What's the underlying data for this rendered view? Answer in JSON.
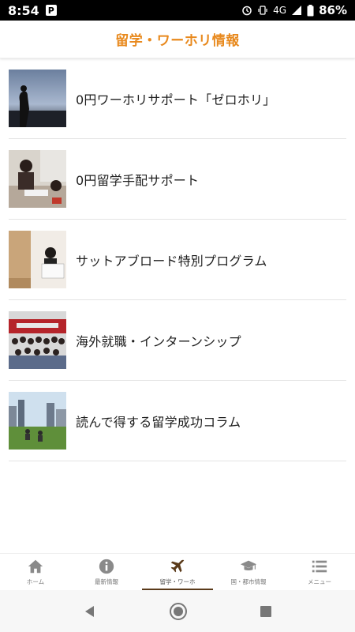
{
  "status_bar": {
    "time": "8:54",
    "app_icon": "P",
    "network": "4G",
    "battery_percent": "86%"
  },
  "header": {
    "title": "留学・ワーホリ情報",
    "accent_color": "#e8891d"
  },
  "items": [
    {
      "label": "0円ワーホリサポート「ゼロホリ」",
      "thumb_icon": "photo-silhouette-city"
    },
    {
      "label": "0円留学手配サポート",
      "thumb_icon": "photo-people-meeting"
    },
    {
      "label": "サットアブロード特別プログラム",
      "thumb_icon": "photo-student-certificate"
    },
    {
      "label": "海外就職・インターンシップ",
      "thumb_icon": "photo-group-office"
    },
    {
      "label": "読んで得する留学成功コラム",
      "thumb_icon": "photo-park-city"
    }
  ],
  "bottom_nav": [
    {
      "label": "ホーム",
      "icon": "home-icon",
      "active": false
    },
    {
      "label": "最新情報",
      "icon": "info-icon",
      "active": false
    },
    {
      "label": "留学・ワーホ",
      "icon": "airplane-icon",
      "active": true
    },
    {
      "label": "国・都市情報",
      "icon": "graduation-cap-icon",
      "active": false
    },
    {
      "label": "メニュー",
      "icon": "menu-list-icon",
      "active": false
    }
  ]
}
